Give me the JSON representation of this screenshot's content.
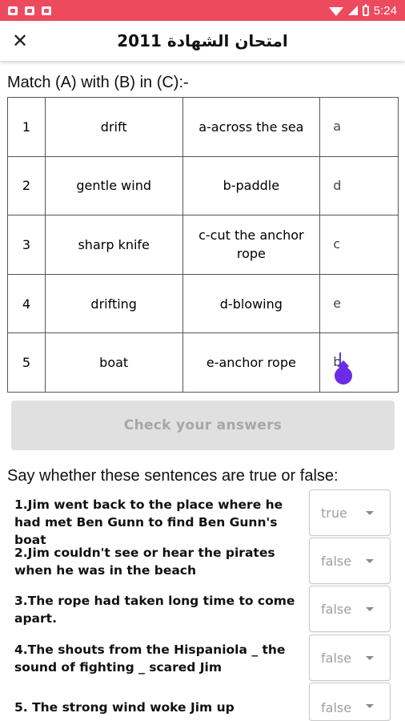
{
  "status_bar": {
    "time": "5:24"
  },
  "app_bar": {
    "title": "امتحان الشهادة 2011",
    "close_glyph": "✕"
  },
  "match": {
    "title": "Match (A) with (B) in (C):-",
    "rows": [
      {
        "num": "1",
        "a": "drift",
        "b": "a-across the sea",
        "answer": "a"
      },
      {
        "num": "2",
        "a": "gentle wind",
        "b": "b-paddle",
        "answer": "d"
      },
      {
        "num": "3",
        "a": "sharp knife",
        "b": "c-cut the anchor rope",
        "answer": "c"
      },
      {
        "num": "4",
        "a": "drifting",
        "b": "d-blowing",
        "answer": "e"
      },
      {
        "num": "5",
        "a": "boat",
        "b": "e-anchor rope",
        "answer": "b"
      }
    ],
    "check_button": "Check your answers"
  },
  "true_false": {
    "title": "Say whether these sentences are true or false:",
    "questions": [
      {
        "text": "1.Jim went back to the place where he had met Ben Gunn to find Ben Gunn's boat",
        "selected": "true"
      },
      {
        "text": "2.Jim couldn't see or hear the pirates when he was in the beach",
        "selected": "false"
      },
      {
        "text": "3.The rope had taken long time to come apart.",
        "selected": "false"
      },
      {
        "text": "4.The shouts from the Hispaniola _ the sound of fighting _ scared Jim",
        "selected": "false"
      },
      {
        "text": "5. The strong wind woke Jim up",
        "selected": "false"
      }
    ]
  },
  "colors": {
    "status_bar": "#ee4a5e",
    "accent": "#6a2ce6",
    "button_bg": "#e0e0e0",
    "button_text": "#a6a6a6"
  }
}
